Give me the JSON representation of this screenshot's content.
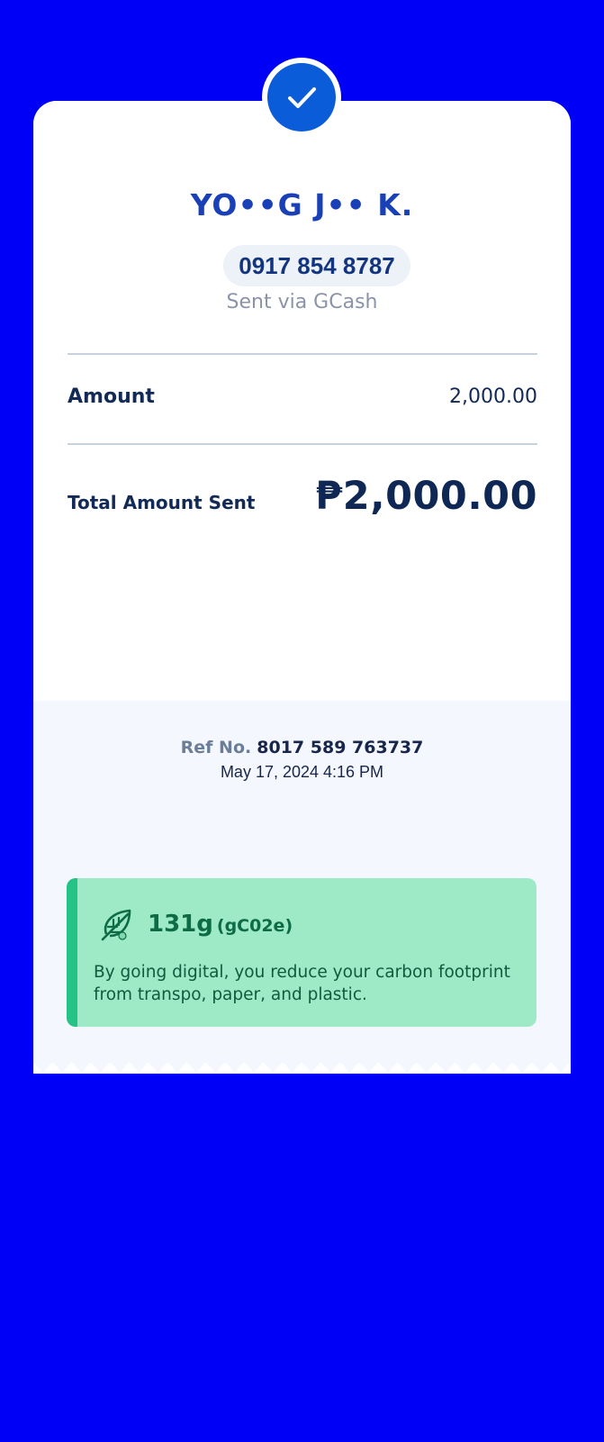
{
  "receipt": {
    "status_icon": "check-icon",
    "recipient_name": "YO••G J•• K.",
    "phone_number": "0917 854 8787",
    "sent_via": "Sent via GCash",
    "amount_label": "Amount",
    "amount_value": "2,000.00",
    "total_label": "Total Amount Sent",
    "total_value": "₱2,000.00",
    "ref_label": "Ref No.",
    "ref_value": "8017 589 763737",
    "date": "May 17, 2024 4:16 PM"
  },
  "eco_card": {
    "icon": "leaf-icon",
    "amount": "131g",
    "unit": "(gC02e)",
    "message": "By going digital, you reduce your carbon footprint from transpo, paper, and plastic."
  },
  "colors": {
    "background": "#0000f6",
    "brand_blue": "#0a5cd9",
    "eco_green": "#9ee9c6",
    "eco_stripe": "#25c385"
  }
}
